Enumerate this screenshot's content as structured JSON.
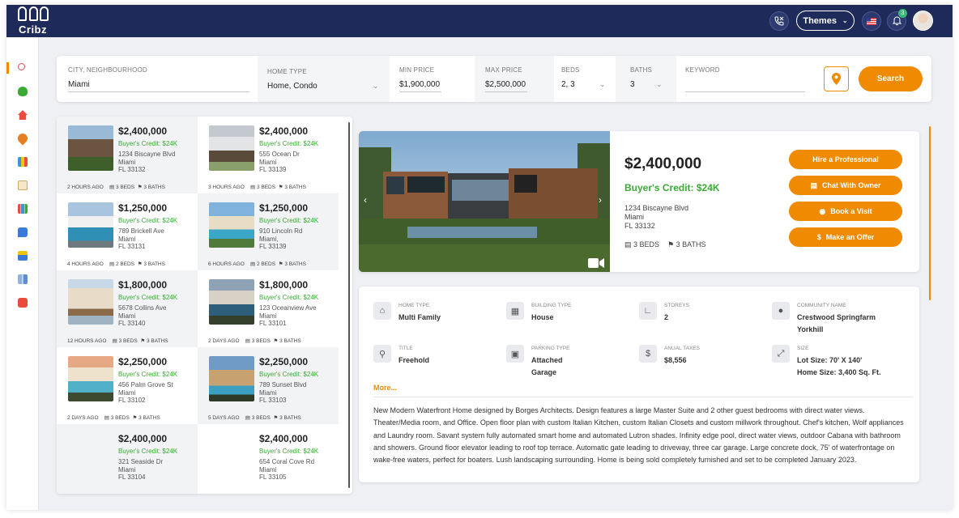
{
  "app": {
    "logo_text": "Cribz"
  },
  "topbar": {
    "themes_label": "Themes",
    "notification_count": "3",
    "icons": [
      "phone-icon",
      "flag-icon",
      "bell-icon"
    ]
  },
  "sidebar": {
    "icons": [
      "search-icon",
      "money-bag-icon",
      "home-icon",
      "location-icon",
      "calculator-icon",
      "document-icon",
      "chart-icon",
      "chat-icon",
      "wallet-icon",
      "building-icon",
      "video-icon"
    ]
  },
  "search": {
    "city_label": "CITY, NEIGHBOURHOOD",
    "city_value": "Miami",
    "home_type_label": "HOME TYPE",
    "home_type_value": "Home, Condo",
    "min_price_label": "MIN PRICE",
    "min_price_value": "$1,900,000",
    "max_price_label": "MAX PRICE",
    "max_price_value": "$2,500,000",
    "beds_label": "BEDS",
    "beds_value": "2, 3",
    "baths_label": "BATHS",
    "baths_value": "3",
    "keyword_label": "KEYWORD",
    "keyword_value": "",
    "search_button": "Search"
  },
  "listings": [
    {
      "price": "$2,400,000",
      "credit": "Buyer's Credit: $24K",
      "addr1": "1234 Biscayne Blvd",
      "addr2": "Miami",
      "addr3": "FL 33132",
      "time": "2 HOURS AGO",
      "beds": "3 BEDS",
      "baths": "3 BATHS"
    },
    {
      "price": "$2,400,000",
      "credit": "Buyer's Credit: $24K",
      "addr1": "555 Ocean Dr",
      "addr2": "Miami",
      "addr3": "FL 33139",
      "time": "3 HOURS AGO",
      "beds": "3 BEDS",
      "baths": "3 BATHS"
    },
    {
      "price": "$1,250,000",
      "credit": "Buyer's Credit: $24K",
      "addr1": "789 Brickell Ave",
      "addr2": "Miami",
      "addr3": "FL 33131",
      "time": "4 HOURS AGO",
      "beds": "2 BEDS",
      "baths": "3 BATHS"
    },
    {
      "price": "$1,250,000",
      "credit": "Buyer's Credit: $24K",
      "addr1": "910 Lincoln Rd",
      "addr2": "Miami,",
      "addr3": "FL 33139",
      "time": "6 HOURS AGO",
      "beds": "2 BEDS",
      "baths": "3 BATHS"
    },
    {
      "price": "$1,800,000",
      "credit": "Buyer's Credit: $24K",
      "addr1": "5678 Collins Ave",
      "addr2": "Miami",
      "addr3": "FL 33140",
      "time": "12 HOURS AGO",
      "beds": "3 BEDS",
      "baths": "3 BATHS"
    },
    {
      "price": "$1,800,000",
      "credit": "Buyer's Credit: $24K",
      "addr1": "123 Oceanview Ave",
      "addr2": "Miami",
      "addr3": "FL 33101",
      "time": "2 DAYS AGO",
      "beds": "3 BEDS",
      "baths": "3 BATHS"
    },
    {
      "price": "$2,250,000",
      "credit": "Buyer's Credit: $24K",
      "addr1": "456 Palm Grove St",
      "addr2": "Miami",
      "addr3": "FL 33102",
      "time": "2 DAYS AGO",
      "beds": "3 BEDS",
      "baths": "3 BATHS"
    },
    {
      "price": "$2,250,000",
      "credit": "Buyer's Credit: $24K",
      "addr1": "789 Sunset Blvd",
      "addr2": "Miami",
      "addr3": "FL 33103",
      "time": "5 DAYS AGO",
      "beds": "3 BEDS",
      "baths": "3 BATHS"
    },
    {
      "price": "$2,400,000",
      "credit": "Buyer's Credit: $24K",
      "addr1": "321 Seaside Dr",
      "addr2": "Miami",
      "addr3": "FL 33104",
      "time": "",
      "beds": "",
      "baths": ""
    },
    {
      "price": "$2,400,000",
      "credit": "Buyer's Credit: $24K",
      "addr1": "654 Coral Cove Rd",
      "addr2": "Miami",
      "addr3": "FL 33105",
      "time": "",
      "beds": "",
      "baths": ""
    }
  ],
  "detail": {
    "price": "$2,400,000",
    "credit": "Buyer's Credit: $24K",
    "addr1": "1234 Biscayne Blvd",
    "addr2": "Miami",
    "addr3": "FL 33132",
    "beds": "3 BEDS",
    "baths": "3 BATHS",
    "actions": {
      "hire": "Hire a Professional",
      "chat": "Chat With Owner",
      "visit": "Book a Visit",
      "offer": "Make an Offer"
    },
    "features": {
      "home_type_label": "HOME TYPE",
      "home_type_value": "Multi Family",
      "building_type_label": "BUILDING TYPE",
      "building_type_value": "House",
      "storeys_label": "STOREYS",
      "storeys_value": "2",
      "community_label": "COMMUNITY NAME",
      "community_value": "Crestwood Springfarm Yorkhill",
      "title_label": "TITLE",
      "title_value": "Freehold",
      "parking_label": "PARKING TYPE",
      "parking_value": "Attached Garage",
      "taxes_label": "ANUAL TAXES",
      "taxes_value": "$8,556",
      "size_label": "SIZE",
      "size_lot": "Lot Size: 70' X 140'",
      "size_home": "Home Size: 3,400 Sq. Ft."
    },
    "more_link": "More...",
    "description": "New Modern Waterfront Home designed by Borges Architects. Design features a large Master Suite and 2 other guest bedrooms with direct water views. Theater/Media room, and Office. Open floor plan with custom Italian Kitchen, custom Italian Closets and custom millwork throughout. Chef's kitchen, Wolf appliances and Laundry room. Savant system fully automated smart home and automated Lutron shades.  Infinity edge pool, direct water views, outdoor Cabana with bathroom and showers. Ground floor elevator leading to roof top terrace. Automatic gate leading to driveway, three car garage. Large concrete dock, 75' of waterfrontage on wake-free waters, perfect for boaters. Lush landscaping surrounding. Home is being sold completely furnished and set to be completed January 2023."
  }
}
